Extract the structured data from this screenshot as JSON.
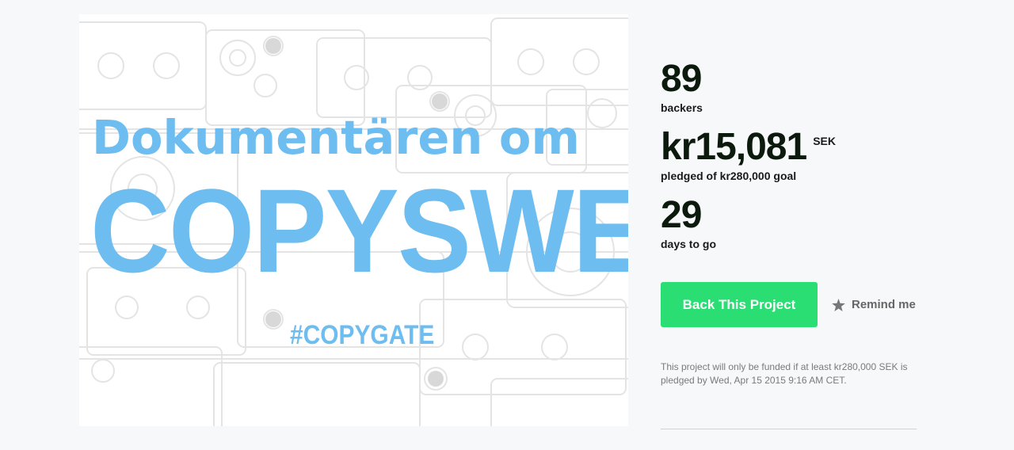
{
  "media": {
    "headline_line1": "Dokumentären om",
    "headline_line2": "COPYSWEDE",
    "hashtag": "#COPYGATE",
    "text_color": "#6dbdf0"
  },
  "stats": {
    "backers_count": "89",
    "backers_label": "backers",
    "pledged_amount": "kr15,081",
    "pledged_currency": "SEK",
    "pledged_label": "pledged of kr280,000 goal",
    "days_count": "29",
    "days_label": "days to go"
  },
  "actions": {
    "back_label": "Back This Project",
    "back_color": "#2bde73",
    "remind_label": "Remind me",
    "remind_icon": "star-icon"
  },
  "funding_note": "This project will only be funded if at least kr280,000 SEK is pledged by Wed, Apr 15 2015 9:16 AM CET."
}
